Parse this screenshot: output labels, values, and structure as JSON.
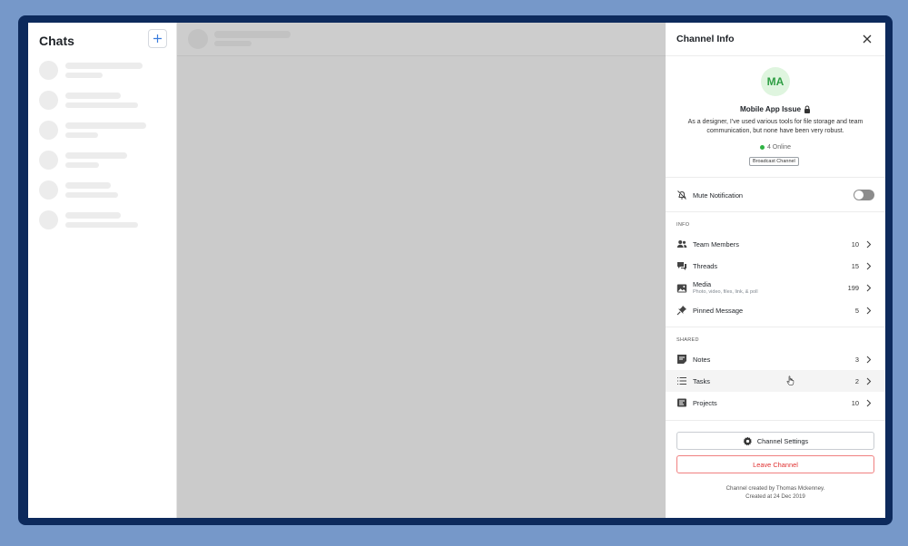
{
  "chats": {
    "title": "Chats",
    "new_icon": "plus-icon",
    "skeleton_rows": [
      {
        "l1": 85,
        "l2": 41
      },
      {
        "l1": 61,
        "l2": 80
      },
      {
        "l1": 89,
        "l2": 36
      },
      {
        "l1": 68,
        "l2": 37
      },
      {
        "l1": 50,
        "l2": 58
      },
      {
        "l1": 61,
        "l2": 80
      }
    ]
  },
  "panel": {
    "title": "Channel Info",
    "close_icon": "close-icon",
    "avatar_initials": "MA",
    "channel_name": "Mobile App Issue",
    "description": "As a designer, I've used various tools for file storage and team communication, but none have been very robust.",
    "online_text": "4 Online",
    "badge": "Broadcast Channel",
    "mute_label": "Mute Notification",
    "mute_enabled": false,
    "info_section": "INFO",
    "info_items": [
      {
        "label": "Team Members",
        "count": "10",
        "icon": "users-icon"
      },
      {
        "label": "Threads",
        "count": "15",
        "icon": "threads-icon"
      },
      {
        "label": "Media",
        "sub": "Photo, video, files, link, & poll",
        "count": "199",
        "icon": "image-icon"
      },
      {
        "label": "Pinned Message",
        "count": "5",
        "icon": "pin-icon"
      }
    ],
    "shared_section": "SHARED",
    "shared_items": [
      {
        "label": "Notes",
        "count": "3",
        "icon": "notes-icon"
      },
      {
        "label": "Tasks",
        "count": "2",
        "icon": "tasks-icon"
      },
      {
        "label": "Projects",
        "count": "10",
        "icon": "projects-icon"
      }
    ],
    "settings_label": "Channel Settings",
    "leave_label": "Leave Channel",
    "footer_line1": "Channel created by Thomas Mckenney.",
    "footer_line2": "Created at 24 Dec 2019"
  },
  "colors": {
    "accent_green": "#2f9e44",
    "danger": "#e03131",
    "background": "#7698c9",
    "frame": "#0d2a5c"
  }
}
